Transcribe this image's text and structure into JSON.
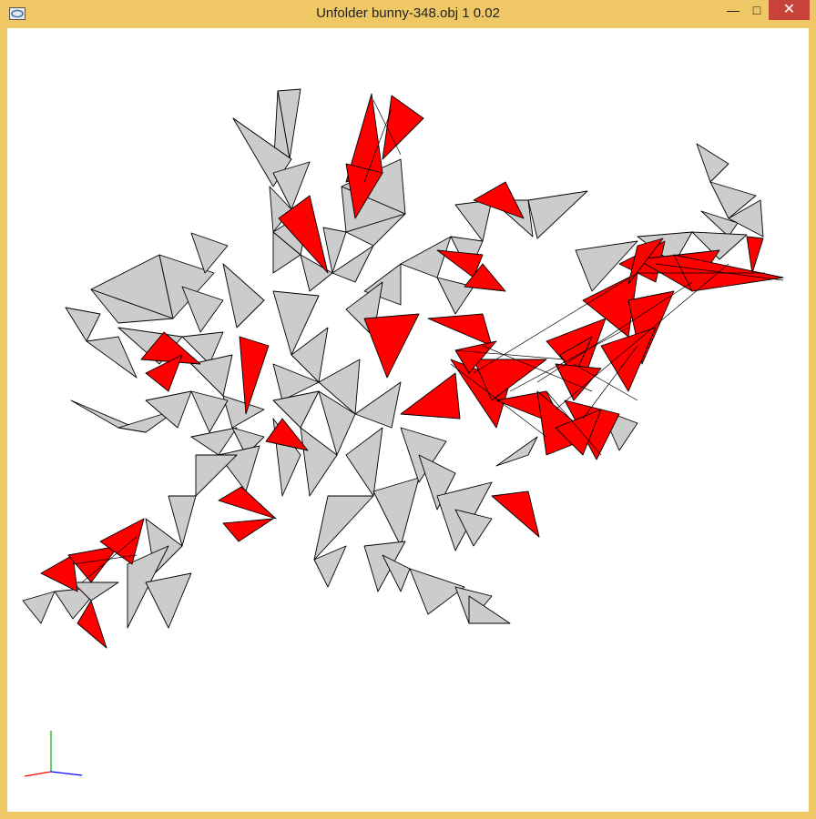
{
  "window": {
    "title": "Unfolder bunny-348.obj 1 0.02",
    "controls": {
      "minimize": "—",
      "maximize": "□",
      "close": "✕"
    },
    "app_icon": "unfolder-app-icon"
  },
  "viewport": {
    "background": "#ffffff",
    "face_fill": "#cccccc",
    "overlap_fill": "#ff0000",
    "edge_color": "#000000",
    "axes": {
      "x_color": "#0000ff",
      "y_color": "#00aa00",
      "z_color": "#ff0000"
    }
  }
}
